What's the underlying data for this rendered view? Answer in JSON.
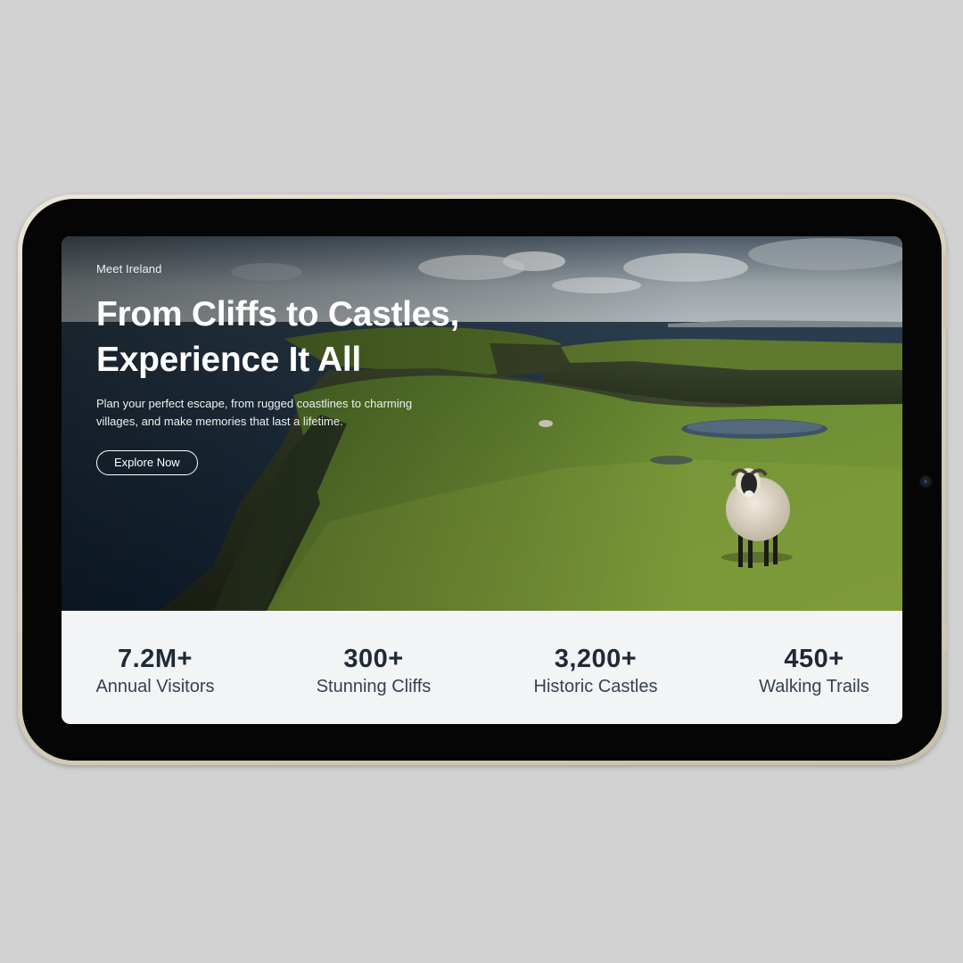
{
  "hero": {
    "eyebrow": "Meet Ireland",
    "headline_line1": "From Cliffs to Castles,",
    "headline_line2": "Experience It All",
    "subtext": "Plan your perfect escape, from rugged coastlines to charming villages, and make memories that last a lifetime.",
    "cta_label": "Explore Now"
  },
  "stats": [
    {
      "value": "7.2M+",
      "label": "Annual Visitors"
    },
    {
      "value": "300+",
      "label": "Stunning Cliffs"
    },
    {
      "value": "3,200+",
      "label": "Historic Castles"
    },
    {
      "value": "450+",
      "label": "Walking Trails"
    }
  ],
  "colors": {
    "page_background": "#d2d2d2",
    "stats_background": "#f3f4f6",
    "stat_text": "#1f2937",
    "device_frame": "#ddd5c4"
  }
}
